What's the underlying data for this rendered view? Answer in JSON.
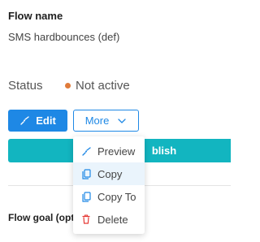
{
  "flow": {
    "name_label": "Flow name",
    "name_value": "SMS hardbounces (def)"
  },
  "status": {
    "label": "Status",
    "value": "Not active",
    "dot_color": "#e07b3a"
  },
  "actions": {
    "edit_label": "Edit",
    "more_label": "More",
    "publish_label": "Publish",
    "publish_visible_text": "blish"
  },
  "more_menu": {
    "items": [
      {
        "label": "Preview",
        "icon": "flow-arrow-icon",
        "highlighted": false
      },
      {
        "label": "Copy",
        "icon": "copy-icon",
        "highlighted": true
      },
      {
        "label": "Copy To",
        "icon": "copy-to-icon",
        "highlighted": false
      },
      {
        "label": "Delete",
        "icon": "trash-icon",
        "highlighted": false
      }
    ]
  },
  "goal": {
    "label_visible": "Flow goal (opt"
  },
  "colors": {
    "primary_blue": "#1e88e5",
    "teal": "#12b5c0",
    "delete_red": "#e53935",
    "highlight": "#eaf4fc"
  }
}
